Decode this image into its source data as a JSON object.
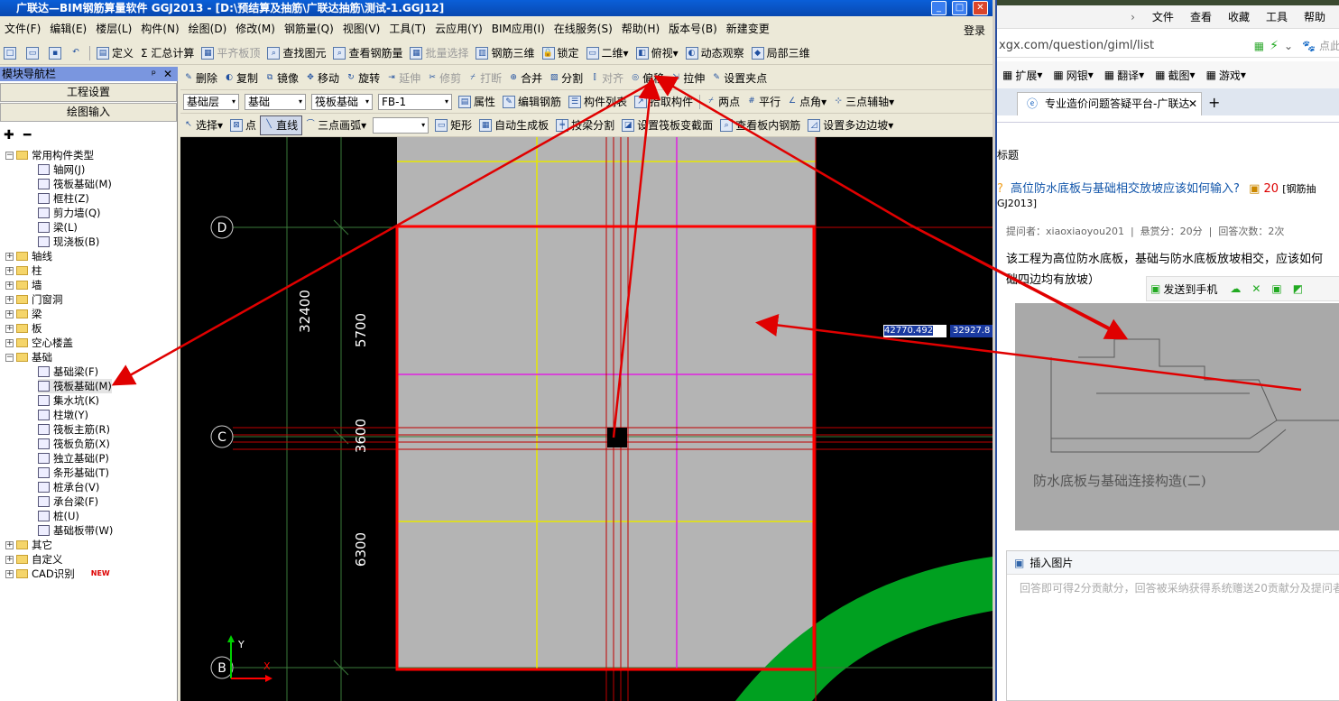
{
  "app": {
    "title": "广联达—BIM钢筋算量软件 GGJ2013 - [D:\\预结算及抽筋\\广联达抽筋\\测试-1.GGJ12]",
    "login": "登录",
    "menus": [
      "文件(F)",
      "编辑(E)",
      "楼层(L)",
      "构件(N)",
      "绘图(D)",
      "修改(M)",
      "钢筋量(Q)",
      "视图(V)",
      "工具(T)",
      "云应用(Y)",
      "BIM应用(I)",
      "在线服务(S)",
      "帮助(H)",
      "版本号(B)",
      "新建变更"
    ],
    "toolbar1": {
      "define": "定义",
      "sum": "Σ 汇总计算",
      "flat_top": "平齐板顶",
      "find": "查找图元",
      "view_rebar": "查看钢筋量",
      "batch_select": "批量选择",
      "rebar3d": "钢筋三维",
      "lock": "锁定",
      "view2d": "二维",
      "top_view": "俯视",
      "dyn_view": "动态观察",
      "local3d": "局部三维"
    },
    "toolbar2": [
      "删除",
      "复制",
      "镜像",
      "移动",
      "旋转",
      "延伸",
      "修剪",
      "打断",
      "合并",
      "分割",
      "对齐",
      "偏移",
      "拉伸",
      "设置夹点"
    ],
    "toolbar2_disabled": [
      "延伸",
      "修剪",
      "打断",
      "对齐"
    ],
    "toolbar3": {
      "layer": "基础层",
      "category": "基础",
      "type": "筏板基础",
      "item": "FB-1",
      "props": "属性",
      "edit_rebar": "编辑钢筋",
      "comp_list": "构件列表",
      "pick": "拾取构件",
      "two_point": "两点",
      "parallel": "平行",
      "point_angle": "点角",
      "three_point_aux": "三点辅轴"
    },
    "toolbar4": {
      "select": "选择",
      "point": "点",
      "line": "直线",
      "arc": "三点画弧",
      "rect": "矩形",
      "auto_gen": "自动生成板",
      "beam_split": "按梁分割",
      "set_section": "设置筏板变截面",
      "view_inner_rebar": "查看板内钢筋",
      "set_slope": "设置多边边坡"
    },
    "nav": {
      "title": "模块导航栏",
      "btn1": "工程设置",
      "btn2": "绘图输入",
      "common": "常用构件类型",
      "common_items": [
        "轴网(J)",
        "筏板基础(M)",
        "框柱(Z)",
        "剪力墙(Q)",
        "梁(L)",
        "现浇板(B)"
      ],
      "folders_a": [
        "轴线",
        "柱",
        "墙",
        "门窗洞",
        "梁",
        "板",
        "空心楼盖"
      ],
      "foundation": "基础",
      "foundation_items": [
        "基础梁(F)",
        "筏板基础(M)",
        "集水坑(K)",
        "柱墩(Y)",
        "筏板主筋(R)",
        "筏板负筋(X)",
        "独立基础(P)",
        "条形基础(T)",
        "桩承台(V)",
        "承台梁(F)",
        "桩(U)",
        "基础板带(W)"
      ],
      "folders_b": [
        "其它",
        "自定义",
        "CAD识别"
      ],
      "new_badge": "NEW"
    },
    "canvas": {
      "dims": [
        "32400",
        "5700",
        "3600",
        "6300"
      ],
      "axes": [
        "D",
        "C",
        "B"
      ],
      "coord_x": "42770.492",
      "coord_y": "32927.8",
      "ucs_y": "Y",
      "ucs_x": "X"
    }
  },
  "browser": {
    "menu": [
      "文件",
      "查看",
      "收藏",
      "工具",
      "帮助"
    ],
    "address": "xgx.com/question/giml/list",
    "search_hint": "点此",
    "fav": [
      "扩展",
      "网银",
      "翻译",
      "截图",
      "游戏"
    ],
    "tab": "专业造价问题答疑平台-广联达",
    "section": "标题",
    "question_title": "高位防水底板与基础相交放坡应该如何输入?",
    "reward": "20",
    "tag": "[钢筋抽",
    "tag2": "GJ2013]",
    "asker": "提问者：xiaoxiaoyou201",
    "bounty": "悬赏分：20分",
    "answers": "回答次数：2次",
    "body1": "该工程为高位防水底板，基础与防水底板放坡相交，应该如何",
    "body2": "础四边均有放坡）",
    "send": "发送到手机",
    "img_caption": "防水底板与基础连接构造(二)",
    "insert_img": "插入图片",
    "answer_hint": "回答即可得2分贡献分，回答被采纳获得系统赠送20贡献分及提问者"
  }
}
